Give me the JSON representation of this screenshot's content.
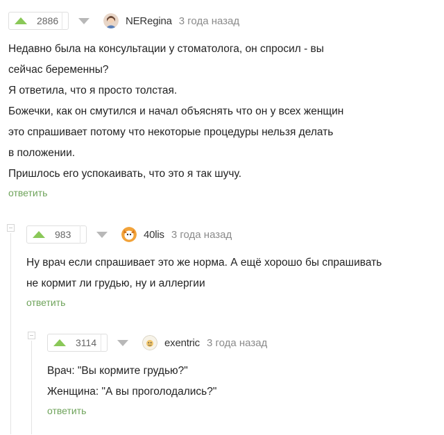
{
  "comments": [
    {
      "votes": "2886",
      "user": "NERegina",
      "time": "3 года назад",
      "lines": [
        "Недавно была на консультации у стоматолога, он спросил - вы",
        "сейчас беременны?",
        "Я ответила, что я просто толстая.",
        "Божечки, как он смутился и начал объяснять что он у всех женщин",
        "это спрашивает потому что некоторые процедуры нельзя делать",
        "в положении.",
        "Пришлось его успокаивать, что это я так шучу."
      ],
      "reply": "ответить"
    },
    {
      "votes": "983",
      "user": "40lis",
      "time": "3 года назад",
      "lines": [
        "Ну врач если спрашивает это же норма. А ещё хорошо бы спрашивать",
        "не кормит ли грудью, ну и аллергии"
      ],
      "reply": "ответить"
    },
    {
      "votes": "3114",
      "user": "exentric",
      "time": "3 года назад",
      "lines": [
        "Врач: \"Вы кормите грудью?\"",
        "Женщина: \"А вы проголодались?\""
      ],
      "reply": "ответить"
    }
  ],
  "colors": {
    "upvote": "#8ac858",
    "reply_link": "#6ea35a"
  }
}
